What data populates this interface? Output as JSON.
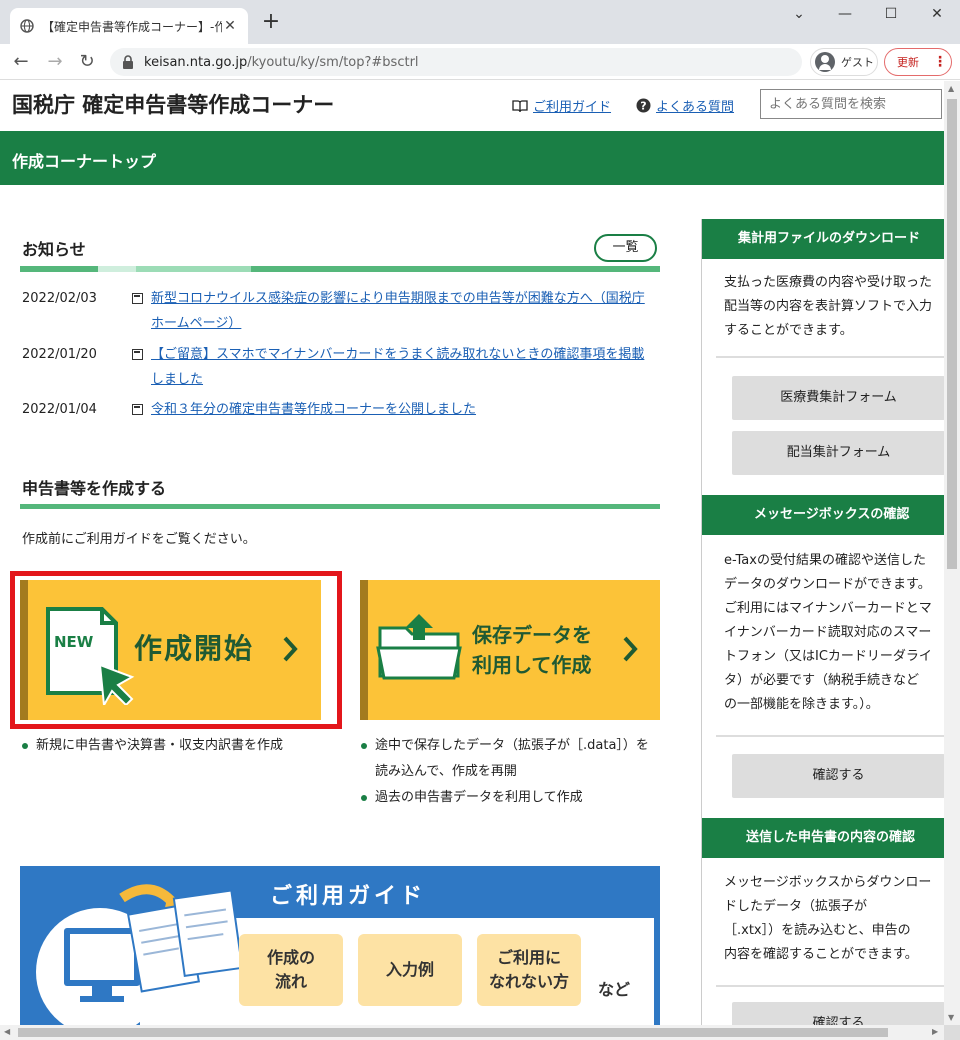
{
  "browser": {
    "tab_title": "【確定申告書等作成コーナー】-作成コ",
    "url_host": "keisan.nta.go.jp",
    "url_path": "/kyoutu/ky/sm/top?#bsctrl",
    "guest_label": "ゲスト",
    "update_label": "更新"
  },
  "header": {
    "site_title": "国税庁 確定申告書等作成コーナー",
    "guide_link": "ご利用ガイド",
    "faq_link": "よくある質問",
    "faq_search_placeholder": "よくある質問を検索"
  },
  "breadcrumb_bar": "作成コーナートップ",
  "news": {
    "heading": "お知らせ",
    "list_button": "一覧",
    "items": [
      {
        "date": "2022/02/03",
        "text": "新型コロナウイルス感染症の影響により申告期限までの申告等が困難な方へ（国税庁ホームページ）"
      },
      {
        "date": "2022/01/20",
        "text": "【ご留意】スマホでマイナンバーカードをうまく読み取れないときの確認事項を掲載しました"
      },
      {
        "date": "2022/01/04",
        "text": "令和３年分の確定申告書等作成コーナーを公開しました"
      }
    ]
  },
  "create": {
    "heading": "申告書等を作成する",
    "intro": "作成前にご利用ガイドをご覧ください。",
    "start_button": "作成開始",
    "new_badge": "NEW",
    "saved_button_line1": "保存データを",
    "saved_button_line2": "利用して作成",
    "start_bullets": [
      "新規に申告書や決算書・収支内訳書を作成"
    ],
    "saved_bullets": [
      "途中で保存したデータ（拡張子が［.data］）を読み込んで、作成を再開",
      "過去の申告書データを利用して作成"
    ]
  },
  "guide_banner": {
    "title": "ご利用ガイド",
    "chips": [
      "作成の\n流れ",
      "入力例",
      "ご利用に\nなれない方"
    ],
    "etc": "など"
  },
  "sidebar": {
    "download": {
      "heading": "集計用ファイルのダウンロード",
      "text": "支払った医療費の内容や受け取った\n配当等の内容を表計算ソフトで入力\nすることができます。",
      "buttons": [
        "医療費集計フォーム",
        "配当集計フォーム"
      ]
    },
    "messagebox": {
      "heading": "メッセージボックスの確認",
      "text": "e-Taxの受付結果の確認や送信した\nデータのダウンロードができます。\nご利用にはマイナンバーカードとマ\nイナンバーカード読取対応のスマー\nトフォン（又はICカードリーダライ\nタ）が必要です（納税手続きなど\nの一部機能を除きます。）。",
      "button": "確認する"
    },
    "sent": {
      "heading": "送信した申告書の内容の確認",
      "text": "メッセージボックスからダウンロー\nドしたデータ（拡張子が\n［.xtx］）を読み込むと、申告の\n内容を確認することができます。",
      "button": "確認する"
    }
  },
  "colors": {
    "green": "#1a7f45",
    "yellow": "#fcc338",
    "blue": "#2f78c4",
    "red": "#e3161b"
  }
}
